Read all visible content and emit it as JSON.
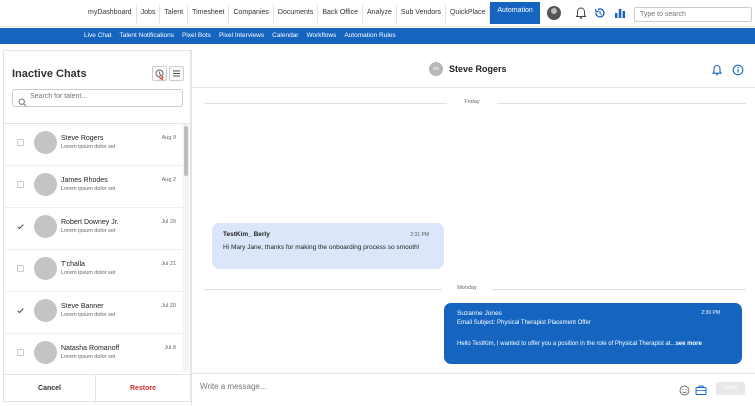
{
  "topnav": {
    "items": [
      "myDashboard",
      "Jobs",
      "Talent",
      "Timesheet",
      "Companies",
      "Documents",
      "Back Office",
      "Analyze",
      "Sub Vendors",
      "QuickPlace",
      "Automation"
    ],
    "active_index": 10,
    "search_placeholder": "Type to search"
  },
  "subnav": {
    "items": [
      "Live Chat",
      "Talent Notifications",
      "Pixel Bots",
      "Pixel Interviews",
      "Calendar",
      "Workflows",
      "Automation Rules"
    ]
  },
  "left_panel": {
    "title": "Inactive Chats",
    "search_placeholder": "Search for talent...",
    "chats": [
      {
        "name": "Steve Rogers",
        "preview": "Lorem ipsum dolor set",
        "date": "Aug 9",
        "checked": false
      },
      {
        "name": "James Rhodes",
        "preview": "Lorem ipsum dolor set",
        "date": "Aug 2",
        "checked": false
      },
      {
        "name": "Robert Downey Jr.",
        "preview": "Lorem ipsum dolor set",
        "date": "Jul 29",
        "checked": true
      },
      {
        "name": "T'challa",
        "preview": "Lorem ipsum dolor set",
        "date": "Jul 21",
        "checked": false
      },
      {
        "name": "Steve Banner",
        "preview": "Lorem ipsum dolor set",
        "date": "Jul 20",
        "checked": true
      },
      {
        "name": "Natasha Romanoff",
        "preview": "Lorem ipsum dolor set",
        "date": "Jul 8",
        "checked": false
      }
    ],
    "cancel_label": "Cancel",
    "restore_label": "Restore",
    "restore_color": "#d32f2f"
  },
  "chat": {
    "contact_name": "Steve Rogers",
    "contact_initials": "SR",
    "day1": "Friday",
    "day2": "Monday",
    "incoming": {
      "sender": "TestKim_ Berly",
      "time": "2:31 PM",
      "text": "Hi Mary Jane, thanks for making the onboarding process so smooth!"
    },
    "outgoing": {
      "sender": "Suzanne Jones",
      "time": "2:30 PM",
      "subject": "Email Subject: Physical Therapist Placement Offer",
      "body": "Hello TestKim, I wanted to offer you a position in the role of Physical Therapist at...",
      "more": "see more"
    },
    "composer_placeholder": "Write a message...",
    "send_label": "Send"
  },
  "colors": {
    "brand_blue": "#1565c0",
    "incoming_bubble": "#dbe6fb"
  }
}
